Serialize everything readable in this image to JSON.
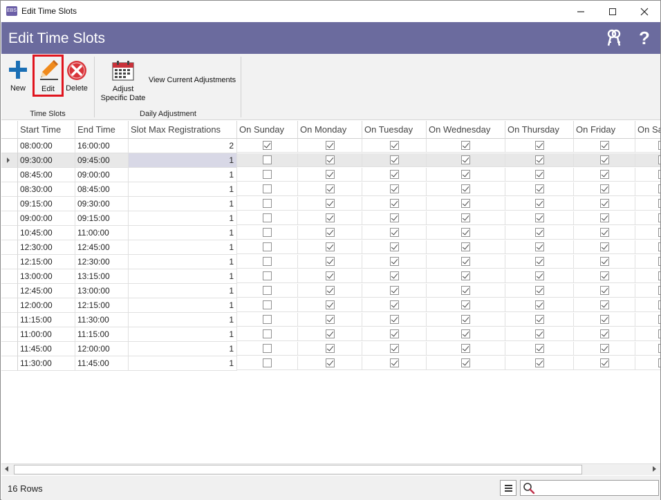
{
  "window": {
    "title": "Edit Time Slots",
    "app_icon_text": "EBS"
  },
  "header": {
    "title": "Edit Time Slots",
    "help_glyph": "?"
  },
  "ribbon": {
    "new_label": "New",
    "edit_label": "Edit",
    "delete_label": "Delete",
    "adjust_label_line1": "Adjust",
    "adjust_label_line2": "Specific Date",
    "view_label": "View Current Adjustments",
    "group_time_slots": "Time Slots",
    "group_daily_adjustment": "Daily Adjustment"
  },
  "grid": {
    "columns": [
      "Start Time",
      "End Time",
      "Slot Max Registrations",
      "On Sunday",
      "On Monday",
      "On Tuesday",
      "On Wednesday",
      "On Thursday",
      "On Friday",
      "On Sat"
    ],
    "selected_row": 1,
    "rows": [
      {
        "start": "08:00:00",
        "end": "16:00:00",
        "max": "2",
        "days": [
          true,
          true,
          true,
          true,
          true,
          true,
          false
        ]
      },
      {
        "start": "09:30:00",
        "end": "09:45:00",
        "max": "1",
        "days": [
          false,
          true,
          true,
          true,
          true,
          true,
          false
        ]
      },
      {
        "start": "08:45:00",
        "end": "09:00:00",
        "max": "1",
        "days": [
          false,
          true,
          true,
          true,
          true,
          true,
          false
        ]
      },
      {
        "start": "08:30:00",
        "end": "08:45:00",
        "max": "1",
        "days": [
          false,
          true,
          true,
          true,
          true,
          true,
          false
        ]
      },
      {
        "start": "09:15:00",
        "end": "09:30:00",
        "max": "1",
        "days": [
          false,
          true,
          true,
          true,
          true,
          true,
          false
        ]
      },
      {
        "start": "09:00:00",
        "end": "09:15:00",
        "max": "1",
        "days": [
          false,
          true,
          true,
          true,
          true,
          true,
          false
        ]
      },
      {
        "start": "10:45:00",
        "end": "11:00:00",
        "max": "1",
        "days": [
          false,
          true,
          true,
          true,
          true,
          true,
          false
        ]
      },
      {
        "start": "12:30:00",
        "end": "12:45:00",
        "max": "1",
        "days": [
          false,
          true,
          true,
          true,
          true,
          true,
          false
        ]
      },
      {
        "start": "12:15:00",
        "end": "12:30:00",
        "max": "1",
        "days": [
          false,
          true,
          true,
          true,
          true,
          true,
          false
        ]
      },
      {
        "start": "13:00:00",
        "end": "13:15:00",
        "max": "1",
        "days": [
          false,
          true,
          true,
          true,
          true,
          true,
          false
        ]
      },
      {
        "start": "12:45:00",
        "end": "13:00:00",
        "max": "1",
        "days": [
          false,
          true,
          true,
          true,
          true,
          true,
          false
        ]
      },
      {
        "start": "12:00:00",
        "end": "12:15:00",
        "max": "1",
        "days": [
          false,
          true,
          true,
          true,
          true,
          true,
          false
        ]
      },
      {
        "start": "11:15:00",
        "end": "11:30:00",
        "max": "1",
        "days": [
          false,
          true,
          true,
          true,
          true,
          true,
          false
        ]
      },
      {
        "start": "11:00:00",
        "end": "11:15:00",
        "max": "1",
        "days": [
          false,
          true,
          true,
          true,
          true,
          true,
          false
        ]
      },
      {
        "start": "11:45:00",
        "end": "12:00:00",
        "max": "1",
        "days": [
          false,
          true,
          true,
          true,
          true,
          true,
          false
        ]
      },
      {
        "start": "11:30:00",
        "end": "11:45:00",
        "max": "1",
        "days": [
          false,
          true,
          true,
          true,
          true,
          true,
          false
        ]
      }
    ]
  },
  "status": {
    "row_count": "16 Rows",
    "search_placeholder": ""
  },
  "colors": {
    "header_band": "#6b6b9e",
    "new_icon": "#1a6fb5",
    "delete_icon": "#d9343a",
    "edit_highlight": "#e0141e",
    "calendar_icon": "#c8323a"
  }
}
